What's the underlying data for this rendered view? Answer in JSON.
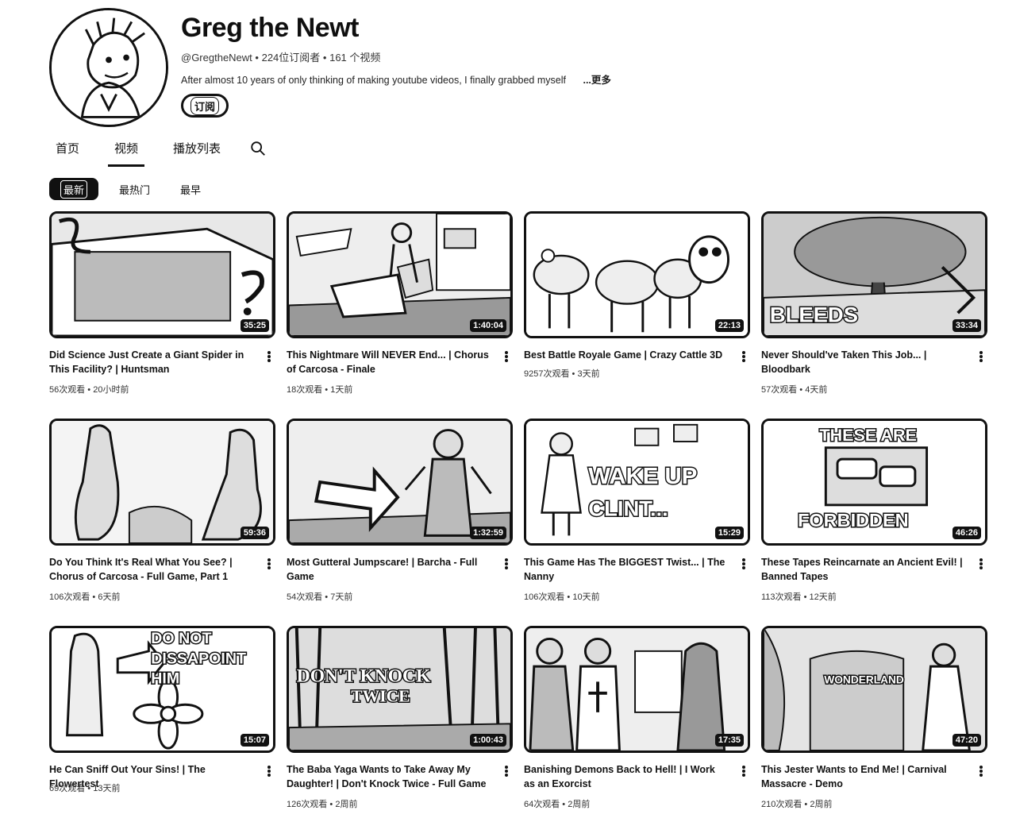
{
  "channel": {
    "name": "Greg the Newt",
    "handle": "@GregtheNewt",
    "subscribers": "224位订阅者",
    "video_count": "161 个视频",
    "description": "After almost 10 years of only thinking of making youtube videos, I finally grabbed myself",
    "more_label": "...更多",
    "subscribe_label": "订阅"
  },
  "tabs": [
    {
      "label": "首页"
    },
    {
      "label": "视频"
    },
    {
      "label": "播放列表"
    }
  ],
  "active_tab": "视频",
  "chips": [
    {
      "label": "最新"
    },
    {
      "label": "最热门"
    },
    {
      "label": "最早"
    }
  ],
  "videos": [
    {
      "title": "Did Science Just Create a Giant Spider in This Facility? | Huntsman",
      "duration": "35:25",
      "views": "56次观看",
      "age": "20小时前"
    },
    {
      "title": "This Nightmare Will NEVER End... | Chorus of Carcosa - Finale",
      "duration": "1:40:04",
      "views": "18次观看",
      "age": "1天前"
    },
    {
      "title": "Best Battle Royale Game | Crazy Cattle 3D",
      "duration": "22:13",
      "views": "9257次观看",
      "age": "3天前"
    },
    {
      "title": "Never Should've Taken This Job... | Bloodbark",
      "duration": "33:34",
      "views": "57次观看",
      "age": "4天前"
    },
    {
      "title": "Do You Think It's Real What You See? | Chorus of Carcosa - Full Game, Part 1",
      "duration": "59:36",
      "views": "106次观看",
      "age": "6天前"
    },
    {
      "title": "Most Gutteral Jumpscare! | Barcha - Full Game",
      "duration": "1:32:59",
      "views": "54次观看",
      "age": "7天前"
    },
    {
      "title": "This Game Has The BIGGEST Twist... | The Nanny",
      "duration": "15:29",
      "views": "106次观看",
      "age": "10天前"
    },
    {
      "title": "These Tapes Reincarnate an Ancient Evil! | Banned Tapes",
      "duration": "46:26",
      "views": "113次观看",
      "age": "12天前"
    },
    {
      "title": "He Can Sniff Out Your Sins! | The Flowertest",
      "duration": "15:07",
      "views": "69次观看",
      "age": "13天前"
    },
    {
      "title": "The Baba Yaga Wants to Take Away My Daughter! | Don't Knock Twice - Full Game",
      "duration": "1:00:43",
      "views": "126次观看",
      "age": "2周前"
    },
    {
      "title": "Banishing Demons Back to Hell! | I Work as an Exorcist",
      "duration": "17:35",
      "views": "64次观看",
      "age": "2周前"
    },
    {
      "title": "This Jester Wants to End Me! | Carnival Massacre - Demo",
      "duration": "47:20",
      "views": "210次观看",
      "age": "2周前"
    }
  ],
  "thumb_text": {
    "t4": "BLEEDS",
    "t7a": "WAKE UP",
    "t7b": "CLINT...",
    "t8a": "THESE ARE",
    "t8b": "FORBIDDEN",
    "t9a": "DO NOT",
    "t9b": "DISSAPOINT",
    "t9c": "HIM",
    "t10a": "DON'T KNOCK",
    "t10b": "TWICE",
    "t12": "WONDERLAND"
  },
  "meta_separator": " • ",
  "colors": {
    "text": "#0f0f0f",
    "border": "#111111",
    "background": "#ffffff"
  },
  "icons": {
    "search": "search-icon",
    "more": "more-vert-icon"
  }
}
